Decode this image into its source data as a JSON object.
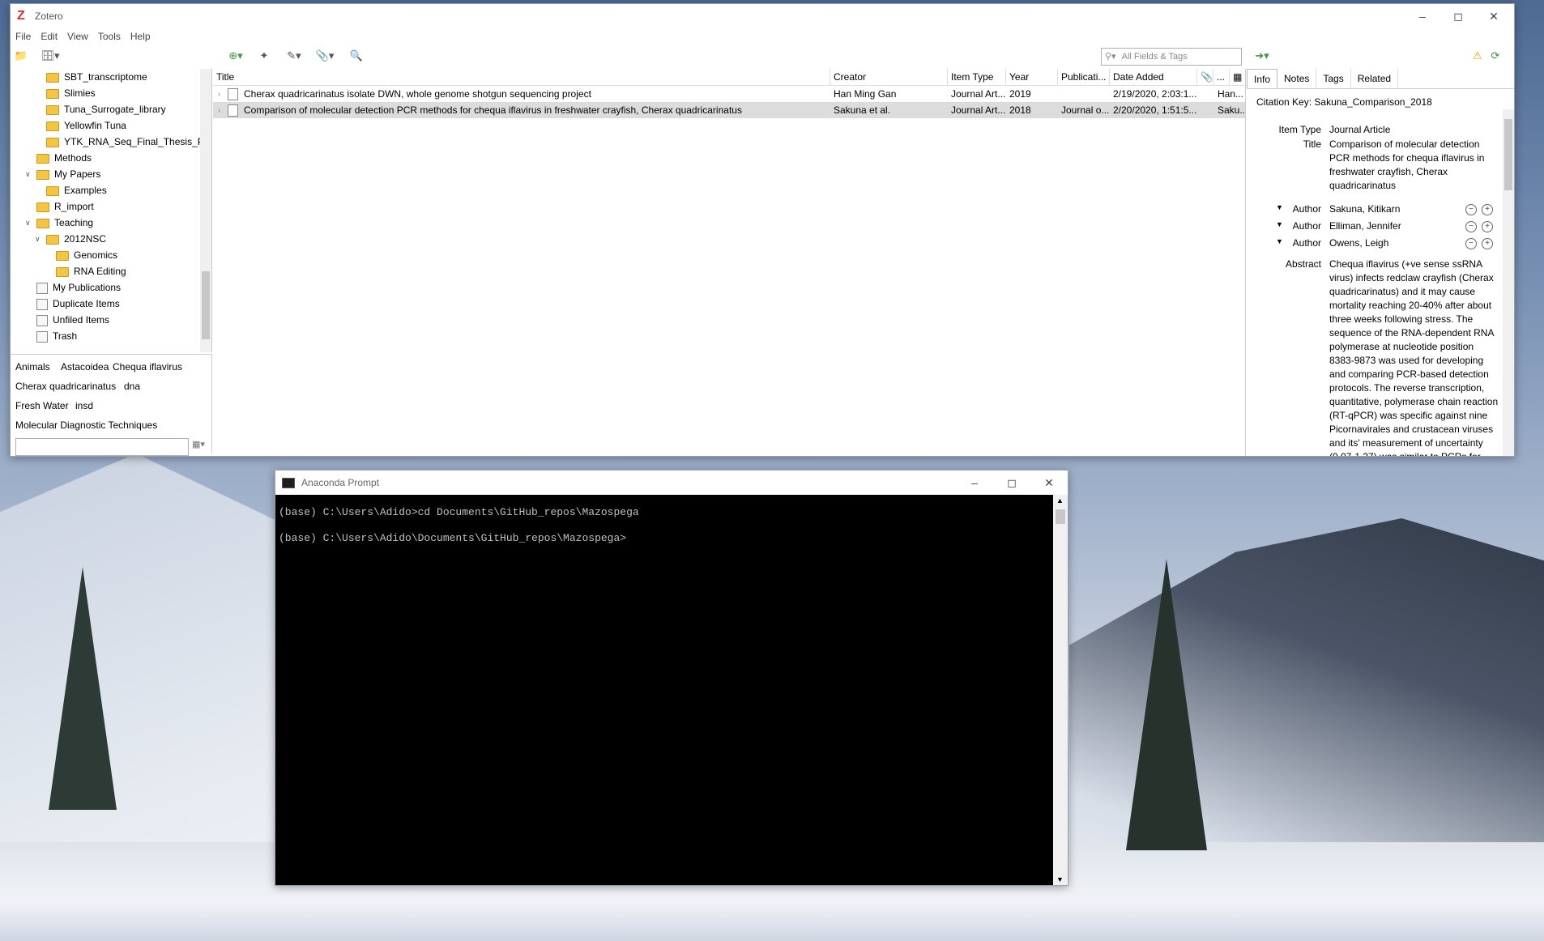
{
  "zotero": {
    "title": "Zotero",
    "menu": [
      "File",
      "Edit",
      "View",
      "Tools",
      "Help"
    ],
    "search_placeholder": "All Fields & Tags",
    "collections": [
      {
        "label": "SBT_transcriptome",
        "type": "folder"
      },
      {
        "label": "Slimies",
        "type": "folder"
      },
      {
        "label": "Tuna_Surrogate_library",
        "type": "folder"
      },
      {
        "label": "Yellowfin Tuna",
        "type": "folder"
      },
      {
        "label": "YTK_RNA_Seq_Final_Thesis_Pa...",
        "type": "folder"
      },
      {
        "label": "Methods",
        "type": "folder"
      },
      {
        "label": "My Papers",
        "type": "folder"
      },
      {
        "label": "Examples",
        "type": "folder"
      },
      {
        "label": "R_import",
        "type": "folder"
      },
      {
        "label": "Teaching",
        "type": "folder"
      },
      {
        "label": "2012NSC",
        "type": "folder"
      },
      {
        "label": "Genomics",
        "type": "folder"
      },
      {
        "label": "RNA Editing",
        "type": "folder"
      },
      {
        "label": "My Publications",
        "type": "system"
      },
      {
        "label": "Duplicate Items",
        "type": "system"
      },
      {
        "label": "Unfiled Items",
        "type": "system"
      },
      {
        "label": "Trash",
        "type": "system"
      }
    ],
    "tags": [
      "Animals",
      "Astacoidea",
      "Chequa iflavirus",
      "Cherax quadricarinatus",
      "dna",
      "Fresh Water",
      "insd",
      "Molecular Diagnostic Techniques"
    ],
    "columns": {
      "title": "Title",
      "creator": "Creator",
      "item_type": "Item Type",
      "year": "Year",
      "publication": "Publicati...",
      "date_added": "Date Added",
      "more": "..."
    },
    "items": [
      {
        "title": "Cherax quadricarinatus isolate DWN, whole genome shotgun sequencing project",
        "creator": "Han Ming Gan",
        "item_type": "Journal Art...",
        "year": "2019",
        "publication": "",
        "date_added": "2/19/2020, 2:03:1...",
        "extra": "Han..."
      },
      {
        "title": "Comparison of molecular detection PCR methods for chequa iflavirus in freshwater crayfish, Cherax quadricarinatus",
        "creator": "Sakuna et al.",
        "item_type": "Journal Art...",
        "year": "2018",
        "publication": "Journal o...",
        "date_added": "2/20/2020, 1:51:5...",
        "extra": "Saku..."
      }
    ],
    "info_tabs": [
      "Info",
      "Notes",
      "Tags",
      "Related"
    ],
    "info": {
      "citation_key_label": "Citation Key:",
      "citation_key": "Sakuna_Comparison_2018",
      "item_type_label": "Item Type",
      "item_type": "Journal Article",
      "title_label": "Title",
      "title": "Comparison of molecular detection PCR methods for chequa iflavirus in freshwater crayfish, Cherax quadricarinatus",
      "author_label": "Author",
      "authors": [
        "Sakuna, Kitikarn",
        "Elliman, Jennifer",
        "Owens, Leigh"
      ],
      "abstract_label": "Abstract",
      "abstract": "Chequa iflavirus (+ve sense ssRNA virus) infects redclaw crayfish (Cherax quadricarinatus) and it may cause mortality reaching 20-40% after about three weeks following stress. The sequence of the RNA-dependent RNA polymerase at nucleotide position 8383-9873 was used for developing and comparing PCR-based detection protocols. The reverse transcription, quantitative, polymerase chain reaction (RT-qPCR) was specific against nine Picornavirales and crustacean viruses and its' measurement of uncertainty (0.07-1.37) was similar to PCRs for other"
    }
  },
  "terminal": {
    "title": "Anaconda Prompt",
    "lines": [
      "(base) C:\\Users\\Adido>cd Documents\\GitHub_repos\\Mazospega",
      "(base) C:\\Users\\Adido\\Documents\\GitHub_repos\\Mazospega>"
    ]
  },
  "colors": {
    "accent_red": "#d92b2b",
    "folder": "#f4c542",
    "selection": "#dcdcdc",
    "console_bg": "#000000"
  }
}
